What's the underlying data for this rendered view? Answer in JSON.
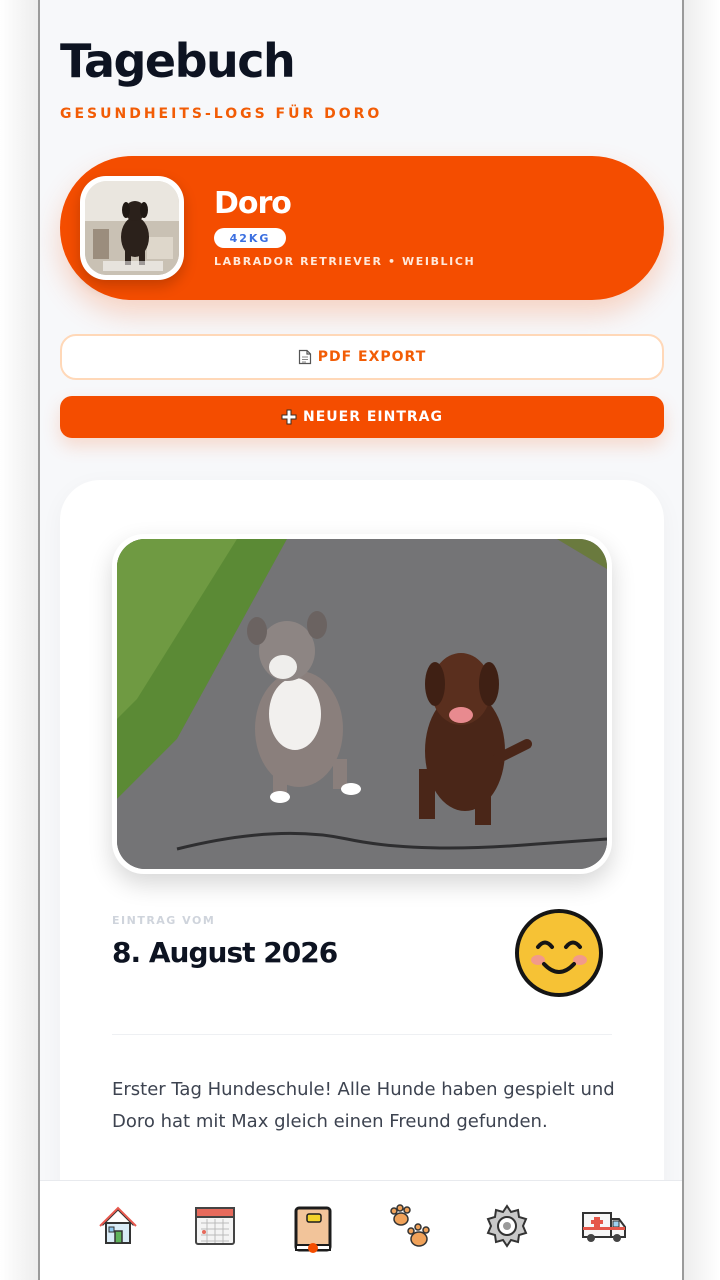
{
  "header": {
    "title": "Tagebuch",
    "subtitle": "GESUNDHEITS-LOGS FÜR DORO"
  },
  "profile": {
    "name": "Doro",
    "weight": "42KG",
    "breed_line": "LABRADOR RETRIEVER • WEIBLICH"
  },
  "actions": {
    "export_label": "PDF EXPORT",
    "export_icon": "document-icon",
    "new_entry_label": "NEUER EINTRAG",
    "new_entry_icon": "plus-icon"
  },
  "entry": {
    "label": "EINTRAG VOM",
    "date": "8. August 2026",
    "mood": "smiling-face",
    "text": "Erster Tag Hundeschule! Alle Hunde haben gespielt und Doro hat mit Max gleich einen Freund gefunden."
  },
  "tab_bar": {
    "items": [
      "home-icon",
      "calendar-icon",
      "diary-icon",
      "paws-icon",
      "settings-icon",
      "ambulance-icon"
    ],
    "active": "diary-icon"
  },
  "colors": {
    "accent": "#f44d00",
    "subtitle": "#f25c05",
    "title": "#0d1321",
    "badge_text": "#3b6fe0"
  }
}
